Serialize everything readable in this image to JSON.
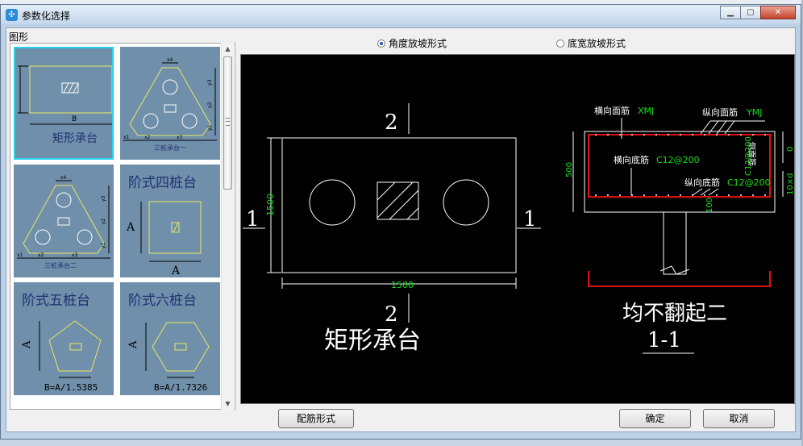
{
  "window": {
    "title": "参数化选择",
    "app_icon": "app-icon",
    "controls": [
      "minimize-icon",
      "maximize-icon",
      "close-icon"
    ]
  },
  "left_panel": {
    "label": "图形",
    "items": [
      {
        "label": "矩形承台",
        "selected": true
      },
      {
        "label": "三桩承台一",
        "selected": false
      },
      {
        "label": "三桩承台二",
        "selected": false
      },
      {
        "label": "阶式四桩台",
        "sub": "A",
        "selected": false
      },
      {
        "label": "阶式五桩台",
        "sub": "B=A/1.5385",
        "selected": false
      },
      {
        "label": "阶式六桩台",
        "sub": "B=A/1.7326",
        "selected": false
      }
    ],
    "thumb_marks": {
      "B": "B",
      "A": "A",
      "x1": "x1",
      "x2": "x2",
      "x3": "x3",
      "x4": "x4",
      "y1": "y1",
      "y2": "y2",
      "y3": "y3"
    }
  },
  "options": [
    {
      "label": "角度放坡形式",
      "checked": true
    },
    {
      "label": "底宽放坡形式",
      "checked": false
    }
  ],
  "drawing": {
    "section_top": "2",
    "section_bottom": "2",
    "section_left": "1",
    "section_right": "1",
    "dim_height": "1500",
    "dim_width": "1500",
    "caption": "矩形承台",
    "rebar_top_trans": "横向面筋",
    "rebar_top_trans_val": "XMJ",
    "rebar_top_long": "纵向面筋",
    "rebar_top_long_val": "YMJ",
    "rebar_bot_trans": "横向底筋",
    "rebar_bot_trans_val": "C12@200",
    "rebar_bot_long": "纵向底筋",
    "rebar_bot_long_val": "C12@200",
    "side_bar_label": "侧面筋",
    "side_bar_val": "C12@200",
    "dim_depth": "500",
    "dim_cover": "0",
    "dim_side": "10×d",
    "dim_embed": "100",
    "note": "均不翻起二",
    "section_name": "1-1"
  },
  "buttons": {
    "rebar_form": "配筋形式",
    "ok": "确定",
    "cancel": "取消"
  },
  "colors": {
    "selection": "#29d1f0",
    "thumb_bg": "#6f8faa",
    "canvas_bg": "#000000",
    "rebar_green": "#19e019",
    "rebar_red": "#e01010",
    "outline_yellow": "#e8e860"
  }
}
